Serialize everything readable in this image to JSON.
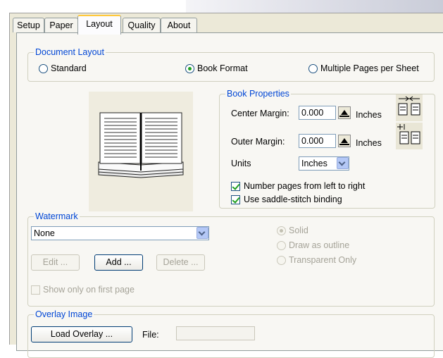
{
  "tabs": [
    {
      "label": "Setup"
    },
    {
      "label": "Paper"
    },
    {
      "label": "Layout"
    },
    {
      "label": "Quality"
    },
    {
      "label": "About"
    }
  ],
  "document_layout": {
    "legend": "Document Layout",
    "options": [
      "Standard",
      "Book Format",
      "Multiple Pages per Sheet"
    ],
    "selected": "Book Format"
  },
  "book_properties": {
    "legend": "Book Properties",
    "center_margin_label": "Center Margin:",
    "center_margin_value": "0.000",
    "center_margin_unit": "Inches",
    "outer_margin_label": "Outer Margin:",
    "outer_margin_value": "0.000",
    "outer_margin_unit": "Inches",
    "units_label": "Units",
    "units_value": "Inches",
    "number_pages_label": "Number pages from left to right",
    "number_pages_checked": true,
    "saddle_stitch_label": "Use saddle-stitch binding",
    "saddle_stitch_checked": true
  },
  "watermark": {
    "legend": "Watermark",
    "selected": "None",
    "edit_label": "Edit ...",
    "add_label": "Add ...",
    "delete_label": "Delete ...",
    "solid_label": "Solid",
    "draw_outline_label": "Draw as outline",
    "transparent_label": "Transparent Only",
    "show_first_page_label": "Show only on first page"
  },
  "overlay": {
    "legend": "Overlay Image",
    "load_label": "Load Overlay ...",
    "file_label": "File:",
    "file_value": ""
  },
  "colors": {
    "accent_legend": "#0046d5",
    "tab_highlight": "#ffc83c",
    "check_green": "#21a121"
  }
}
